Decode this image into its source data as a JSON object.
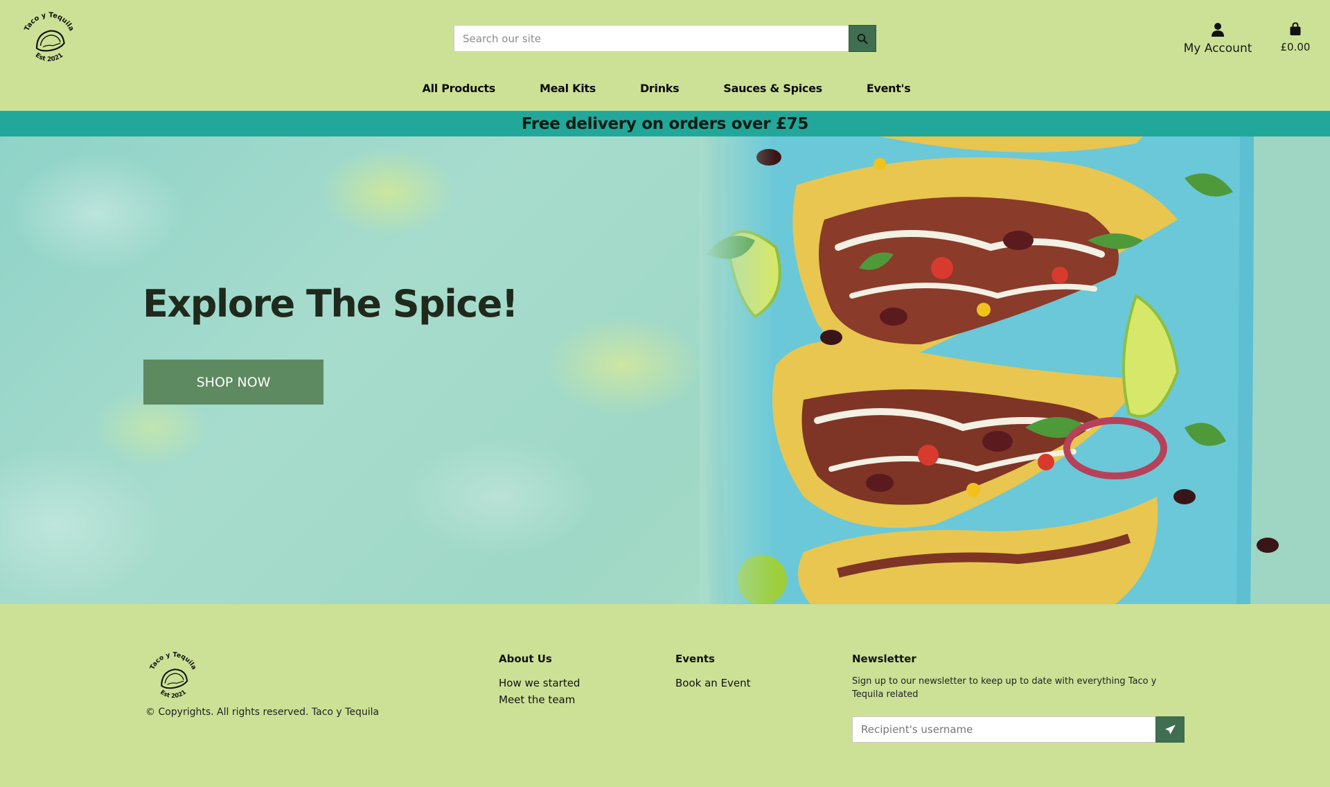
{
  "brand": {
    "logo_top": "Taco y Tequila",
    "logo_bottom": "Est 2021"
  },
  "search": {
    "placeholder": "Search our site",
    "icon": "search-icon"
  },
  "account": {
    "label": "My Account",
    "icon": "user-icon"
  },
  "cart": {
    "total": "£0.00",
    "icon": "shopping-bag-icon"
  },
  "nav": {
    "items": [
      {
        "label": "All Products"
      },
      {
        "label": "Meal Kits"
      },
      {
        "label": "Drinks"
      },
      {
        "label": "Sauces & Spices"
      },
      {
        "label": "Event's"
      }
    ]
  },
  "banner": {
    "text": "Free delivery on orders over £75"
  },
  "hero": {
    "title": "Explore The Spice!",
    "cta": "SHOP NOW"
  },
  "footer": {
    "copyright": "© Copyrights. All rights reserved. Taco y Tequila",
    "about": {
      "heading": "About Us",
      "links": [
        "How we started",
        "Meet the team"
      ]
    },
    "events": {
      "heading": "Events",
      "links": [
        "Book an Event"
      ]
    },
    "newsletter": {
      "heading": "Newsletter",
      "text": "Sign up to our newsletter to keep up to date with everything Taco y Tequila related",
      "placeholder": "Recipient's username",
      "icon": "send-icon"
    }
  },
  "colors": {
    "page_bg": "#cce196",
    "banner_bg": "#22a89a",
    "button_dark": "#3f6e50",
    "cta_green": "#5d8a60"
  }
}
